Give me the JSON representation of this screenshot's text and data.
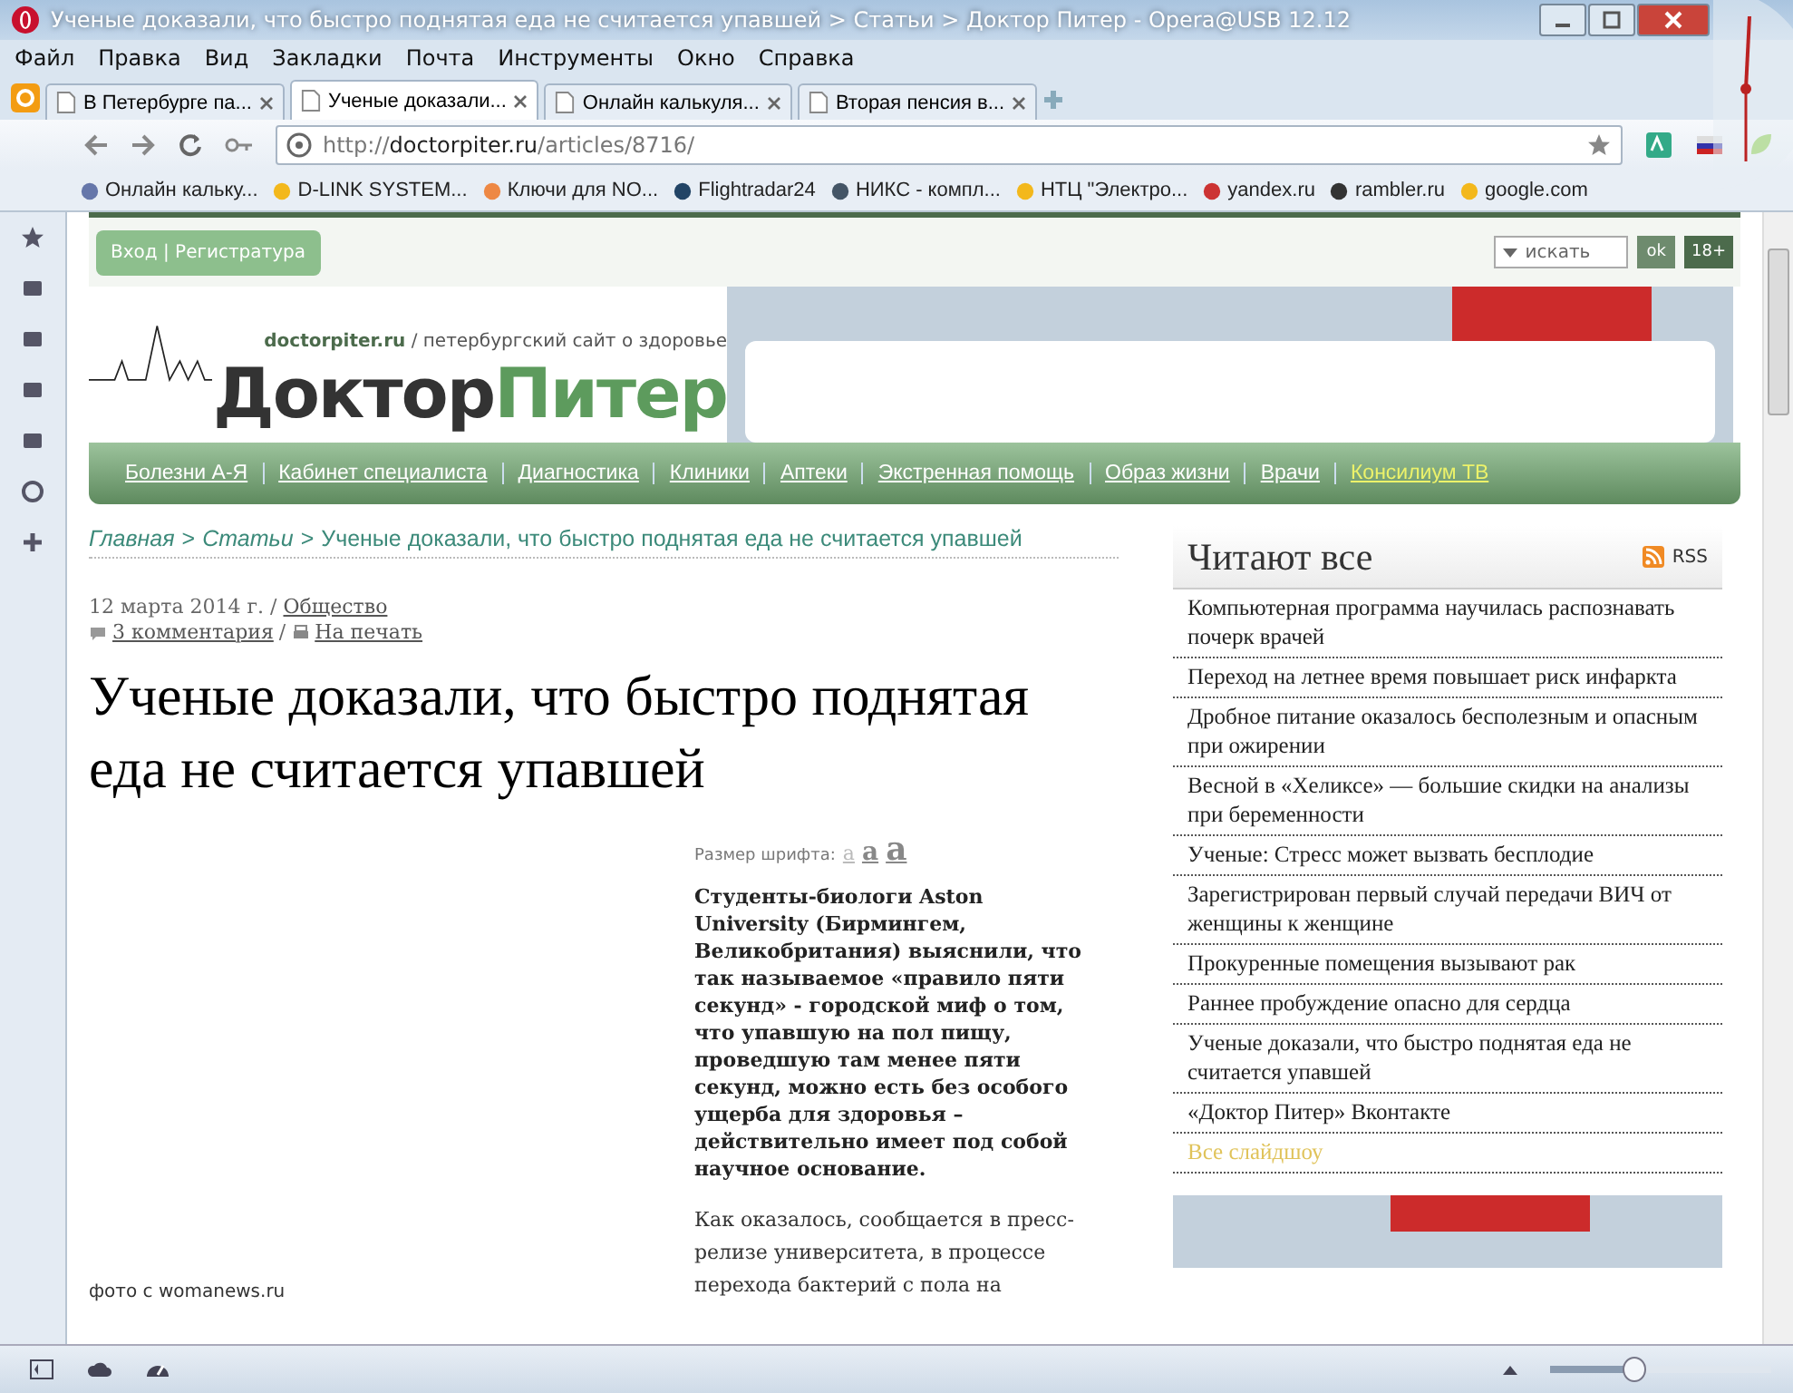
{
  "window": {
    "title": "Ученые доказали, что быстро поднятая еда не считается упавшей > Статьи > Доктор Питер - Opera@USB 12.12"
  },
  "menu": [
    "Файл",
    "Правка",
    "Вид",
    "Закладки",
    "Почта",
    "Инструменты",
    "Окно",
    "Справка"
  ],
  "tabs": [
    {
      "label": "В Петербурге па...",
      "selected": false
    },
    {
      "label": "Ученые доказали...",
      "selected": true
    },
    {
      "label": "Онлайн калькуля...",
      "selected": false
    },
    {
      "label": "Вторая пенсия в...",
      "selected": false
    }
  ],
  "address": {
    "prefix": "http://",
    "domain": "doctorpiter.ru",
    "path": "/articles/8716/"
  },
  "bookmarks": [
    "Онлайн кальку...",
    "D-LINK SYSTEM...",
    "Ключи для NO...",
    "Flightradar24",
    "НИКС - компл...",
    "НТЦ \"Электро...",
    "yandex.ru",
    "rambler.ru",
    "google.com"
  ],
  "site": {
    "login": "Вход | Регистратура",
    "search_placeholder": "искать",
    "ok": "ok",
    "age": "18+",
    "domain": "doctorpiter.ru",
    "tagline": "/ петербургский сайт о здоровье",
    "logo_parts": [
      "Доктор",
      "Питер"
    ]
  },
  "nav": [
    {
      "label": "Болезни А-Я",
      "kind": "normal"
    },
    {
      "label": "Кабинет специалиста",
      "kind": "normal"
    },
    {
      "label": "Диагностика",
      "kind": "normal"
    },
    {
      "label": "Клиники",
      "kind": "normal"
    },
    {
      "label": "Аптеки",
      "kind": "normal"
    },
    {
      "label": "Экстренная помощь",
      "kind": "normal"
    },
    {
      "label": "Образ жизни",
      "kind": "normal"
    },
    {
      "label": "Врачи",
      "kind": "normal"
    },
    {
      "label": "Консилиум ТВ",
      "kind": "highlight"
    }
  ],
  "breadcrumb": [
    {
      "label": "Главная",
      "kind": "link"
    },
    {
      "label": ">",
      "kind": "sep"
    },
    {
      "label": "Статьи",
      "kind": "link"
    },
    {
      "label": ">",
      "kind": "sep"
    },
    {
      "label": "Ученые доказали, что быстро поднятая еда не считается упавшей",
      "kind": "current"
    }
  ],
  "article": {
    "date": "12 марта 2014 г. /",
    "category": "Общество",
    "comments": "3 комментария",
    "sep": "/",
    "print": "На печать",
    "title": "Ученые доказали, что быстро поднятая еда не считается упавшей",
    "photo_caption": "фото с womanews.ru",
    "font_size_label": "Размер шрифта:",
    "font_sizes": [
      {
        "label": "a",
        "selected": true
      },
      {
        "label": "a",
        "selected": false
      },
      {
        "label": "a",
        "selected": false
      }
    ],
    "lead": "Студенты-биологи Aston University (Бирмингем, Великобритания) выяснили, что так называемое «правило пяти секунд» - городской миф о том, что упавшую на пол пищу, проведшую там менее пяти секунд, можно есть без особого ущерба для здоровья – действительно имеет под собой научное основание.",
    "body": "Как оказалось, сообщается в пресс-релизе университета, в процессе перехода бактерий с пола на"
  },
  "sidebar": {
    "heading": "Читают все",
    "rss": "RSS",
    "items": [
      {
        "label": "Компьютерная программа научилась распознавать почерк врачей",
        "kind": "article"
      },
      {
        "label": "Переход на летнее время повышает риск инфаркта",
        "kind": "article"
      },
      {
        "label": "Дробное питание оказалось бесполезным и опасным при ожирении",
        "kind": "article"
      },
      {
        "label": "Весной в «Хеликсе» — большие скидки на анализы при беременности",
        "kind": "article"
      },
      {
        "label": "Ученые: Стресс может вызвать бесплодие",
        "kind": "article"
      },
      {
        "label": "Зарегистрирован первый случай передачи ВИЧ от женщины к женщине",
        "kind": "article"
      },
      {
        "label": "Прокуренные помещения вызывают рак",
        "kind": "article"
      },
      {
        "label": "Раннее пробуждение опасно для сердца",
        "kind": "article"
      },
      {
        "label": "Ученые доказали, что быстро поднятая еда не считается упавшей",
        "kind": "article"
      },
      {
        "label": "«Доктор Питер» Вконтакте",
        "kind": "article"
      },
      {
        "label": "Все слайдшоу",
        "kind": "more"
      }
    ]
  },
  "status_bar": {
    "zoom": {
      "level": 0.38
    }
  }
}
